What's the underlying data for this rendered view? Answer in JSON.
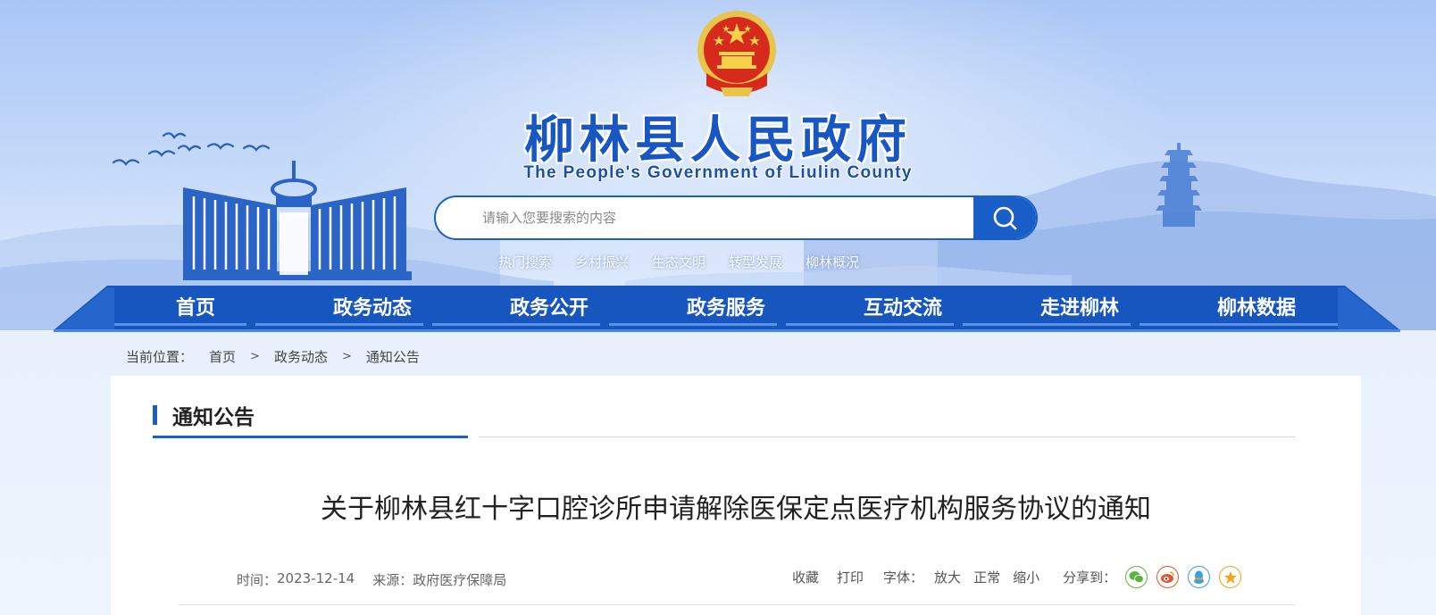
{
  "site": {
    "title": "柳林县人民政府",
    "subtitle": "The People's Government of Liulin County"
  },
  "search": {
    "placeholder": "请输入您要搜索的内容",
    "value": ""
  },
  "hot_searches": [
    "热门搜索",
    "乡村振兴",
    "生态文明",
    "转型发展",
    "柳林概况"
  ],
  "nav": [
    "首页",
    "政务动态",
    "政务公开",
    "政务服务",
    "互动交流",
    "走进柳林",
    "柳林数据"
  ],
  "breadcrumb": {
    "prefix": "当前位置：",
    "items": [
      "首页",
      "政务动态",
      "通知公告"
    ],
    "separator": ">"
  },
  "section": {
    "title": "通知公告"
  },
  "article": {
    "title": "关于柳林县红十字口腔诊所申请解除医保定点医疗机构服务协议的通知",
    "time_label": "时间：",
    "time": "2023-12-14",
    "source_label": "来源：",
    "source": "政府医疗保障局",
    "favorite": "收藏",
    "print": "打印",
    "font_label": "字体：",
    "font_large": "放大",
    "font_normal": "正常",
    "font_small": "缩小",
    "share_label": "分享到："
  },
  "colors": {
    "brand_blue": "#1a5fc7",
    "nav_blue": "#1756be",
    "title_blue": "#1856c4",
    "wechat": "#5bb33b",
    "weibo": "#e8542f",
    "qq": "#3aa0e6",
    "qzone": "#f2a519"
  },
  "share_icons": [
    "wechat-icon",
    "weibo-icon",
    "qq-icon",
    "qzone-icon"
  ]
}
